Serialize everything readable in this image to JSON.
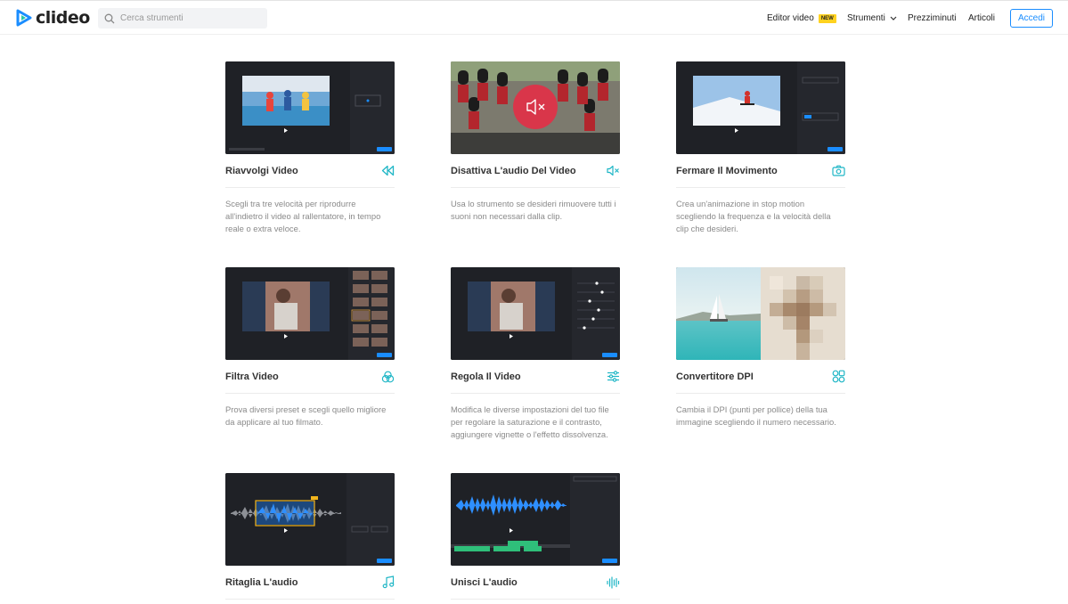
{
  "header": {
    "logo_text": "clideo",
    "search_placeholder": "Cerca strumenti",
    "nav": {
      "editor_label": "Editor video",
      "editor_badge": "NEW",
      "tools_label": "Strumenti",
      "prices_label": "Prezziminuti",
      "articles_label": "Articoli"
    },
    "login_label": "Accedi"
  },
  "colors": {
    "accent": "#1a8dff",
    "icon_teal": "#1fb6c6",
    "badge": "#ffd21f"
  },
  "cards": [
    {
      "title": "Riavvolgi Video",
      "icon": "rewind-icon",
      "description": "Scegli tra tre velocità per riprodurre all'indietro il video al rallentatore, in tempo reale o extra veloce."
    },
    {
      "title": "Disattiva L'audio Del Video",
      "icon": "mute-icon",
      "description": "Usa lo strumento se desideri rimuovere tutti i suoni non necessari dalla clip."
    },
    {
      "title": "Fermare Il Movimento",
      "icon": "camera-icon",
      "description": "Crea un'animazione in stop motion scegliendo la frequenza e la velocità della clip che desideri."
    },
    {
      "title": "Filtra Video",
      "icon": "filter-circles-icon",
      "description": "Prova diversi preset e scegli quello migliore da applicare al tuo filmato."
    },
    {
      "title": "Regola Il Video",
      "icon": "sliders-icon",
      "description": "Modifica le diverse impostazioni del tuo file per regolare la saturazione e il contrasto, aggiungere vignette o l'effetto dissolvenza."
    },
    {
      "title": "Convertitore DPI",
      "icon": "dpi-shapes-icon",
      "description": "Cambia il DPI (punti per pollice) della tua immagine scegliendo il numero necessario."
    },
    {
      "title": "Ritaglia L'audio",
      "icon": "music-note-icon",
      "description": ""
    },
    {
      "title": "Unisci L'audio",
      "icon": "waveform-icon",
      "description": ""
    }
  ]
}
